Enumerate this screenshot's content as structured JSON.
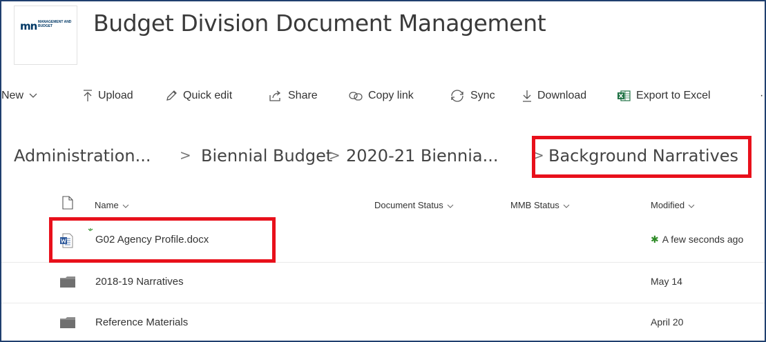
{
  "site": {
    "logo_mark": "mn",
    "logo_text": "MANAGEMENT AND BUDGET",
    "title": "Budget Division Document Management"
  },
  "commands": {
    "new": "New",
    "upload": "Upload",
    "quick_edit": "Quick edit",
    "share": "Share",
    "copy_link": "Copy link",
    "sync": "Sync",
    "download": "Download",
    "export": "Export to Excel",
    "more": "·"
  },
  "breadcrumb": {
    "items": [
      "Administration...",
      "Biennial Budget",
      "2020-21 Biennia...",
      "Background Narratives"
    ],
    "separator": ">"
  },
  "columns": {
    "name": "Name",
    "document_status": "Document Status",
    "mmb_status": "MMB Status",
    "modified": "Modified"
  },
  "rows": [
    {
      "icon": "word-doc-icon",
      "name": "G02 Agency Profile.docx",
      "modified": "A few seconds ago",
      "new": true
    },
    {
      "icon": "folder-icon",
      "name": "2018-19 Narratives",
      "modified": "May 14"
    },
    {
      "icon": "folder-icon",
      "name": "Reference Materials",
      "modified": "April 20"
    }
  ],
  "colors": {
    "highlight": "#e8101b",
    "new_indicator": "#2e8b27",
    "word": "#2b579a",
    "excel": "#217346"
  }
}
